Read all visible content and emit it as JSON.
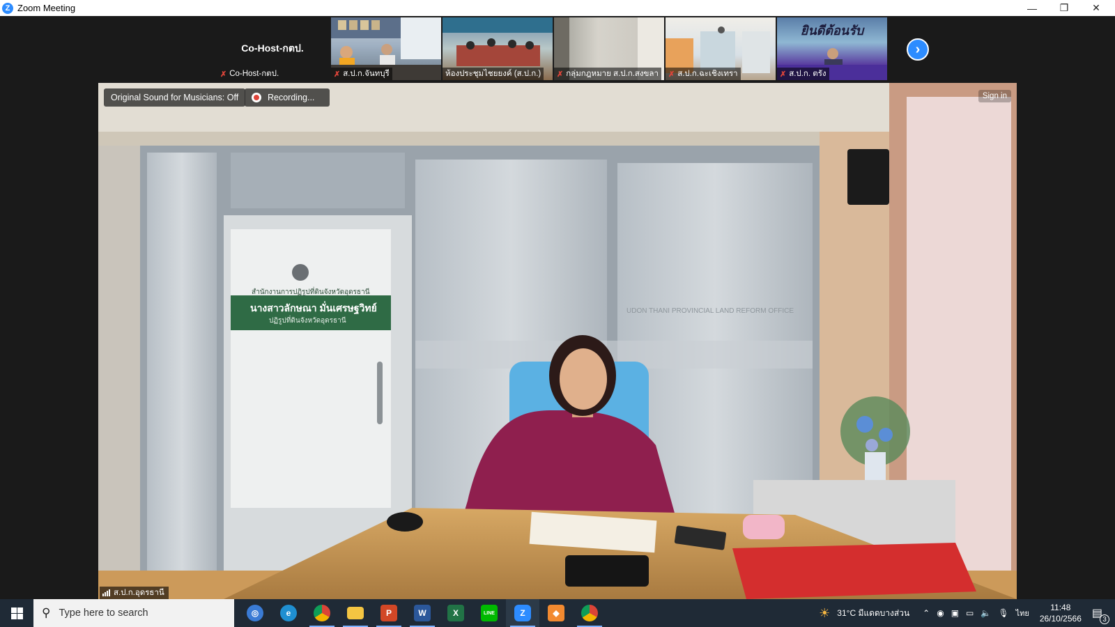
{
  "window": {
    "title": "Zoom Meeting",
    "minimize": "—",
    "restore": "❐",
    "close": "✕"
  },
  "gallery": {
    "cohost": {
      "name": "Co-Host-กตป.",
      "label": "Co-Host-กตป."
    },
    "tiles": [
      {
        "label": "ส.ป.ก.จันทบุรี",
        "muted": true
      },
      {
        "label": "ห้องประชุมไชยยงค์ (ส.ป.ก.)",
        "muted": false
      },
      {
        "label": "กลุ่มกฎหมาย ส.ป.ก.สงขลา",
        "muted": true
      },
      {
        "label": "ส.ป.ก.ฉะเชิงเทรา",
        "muted": true
      },
      {
        "label": "ส.ป.ก. ตรัง",
        "muted": true
      }
    ],
    "welcome_banner": "ยินดีต้อนรับ",
    "next_icon": "›"
  },
  "main": {
    "original_sound": "Original Sound for Musicians: Off",
    "recording": "Recording...",
    "sign_in": "Sign in",
    "speaker_label": "ส.ป.ก.อุดรธานี",
    "door_sign": {
      "line1": "สำนักงานการปฏิรูปที่ดินจังหวัดอุดรธานี",
      "line2": "นางสาวลักษณา มั่นเศรษฐวิทย์",
      "line3": "ปฏิรูปที่ดินจังหวัดอุดรธานี"
    },
    "window_text": "UDON THANI PROVINCIAL LAND REFORM OFFICE"
  },
  "taskbar": {
    "search_placeholder": "Type here to search",
    "apps": [
      {
        "name": "zoom-workplace",
        "glyph": "◎",
        "color": "#3a7bd5"
      },
      {
        "name": "edge",
        "glyph": "e",
        "color": "#1f8fd1"
      },
      {
        "name": "chrome",
        "glyph": "●",
        "color": "#db4437"
      },
      {
        "name": "file-explorer",
        "glyph": "▬",
        "color": "#f4c542"
      },
      {
        "name": "powerpoint",
        "glyph": "P",
        "color": "#d24726"
      },
      {
        "name": "word",
        "glyph": "W",
        "color": "#2b579a"
      },
      {
        "name": "excel",
        "glyph": "X",
        "color": "#217346"
      },
      {
        "name": "line",
        "glyph": "LINE",
        "color": "#00b900"
      },
      {
        "name": "zoom",
        "glyph": "Z",
        "color": "#2d8cff"
      },
      {
        "name": "app-orange",
        "glyph": "◆",
        "color": "#f28a30"
      },
      {
        "name": "chrome-profile",
        "glyph": "●",
        "color": "#db4437"
      }
    ],
    "weather": "31°C มีแดดบางส่วน",
    "language": "ไทย",
    "time": "11:48",
    "date": "26/10/2566",
    "notification_count": "3"
  }
}
